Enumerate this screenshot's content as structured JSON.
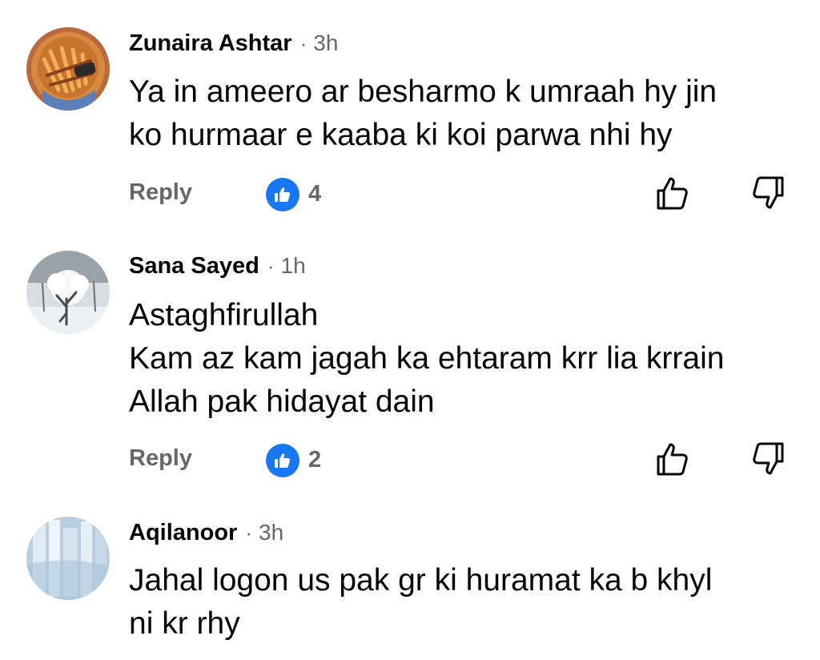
{
  "comments": [
    {
      "author": "Zunaira Ashtar",
      "separator": "·",
      "time": "3h",
      "lines": [
        "Ya in ameero ar besharmo k umraah hy jin",
        "ko hurmaar e kaaba ki koi parwa nhi hy"
      ],
      "reply_label": "Reply",
      "reaction_count": "4",
      "reaction_icon": "like-reaction-icon"
    },
    {
      "author": "Sana Sayed",
      "separator": "·",
      "time": "1h",
      "lines": [
        "Astaghfirullah",
        "Kam az kam jagah ka ehtaram krr lia krrain",
        "Allah pak hidayat dain"
      ],
      "reply_label": "Reply",
      "reaction_count": "2",
      "reaction_icon": "like-reaction-icon"
    },
    {
      "author": "Aqilanoor",
      "separator": "·",
      "time": "3h",
      "lines": [
        "Jahal logon us pak gr ki huramat ka b khyl",
        "ni kr rhy"
      ]
    }
  ],
  "colors": {
    "reaction_blue": "#1877f2",
    "secondary_text": "#65676b",
    "primary_text": "#050505"
  }
}
